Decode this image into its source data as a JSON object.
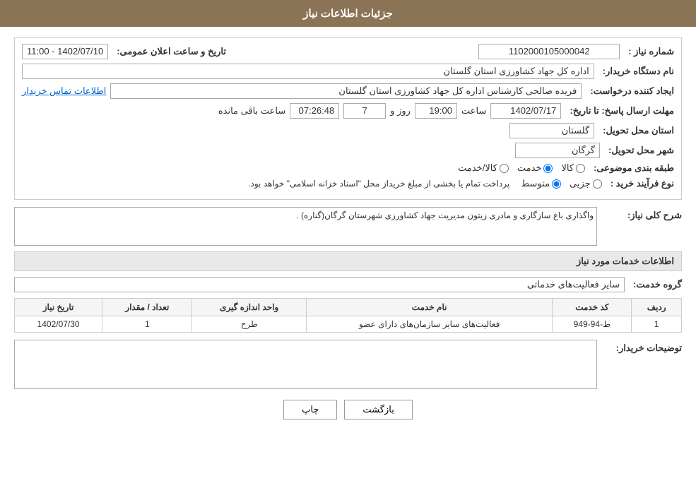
{
  "header": {
    "title": "جزئیات اطلاعات نیاز"
  },
  "fields": {
    "shomare_niaz_label": "شماره نیاز :",
    "shomare_niaz_value": "1102000105000042",
    "nam_dastgah_label": "نام دستگاه خریدار:",
    "nam_dastgah_value": "اداره کل جهاد کشاورزی استان گلستان",
    "ijad_konande_label": "ایجاد کننده درخواست:",
    "ijad_konande_value": "فریده صالحی کارشناس اداره کل جهاد کشاورزی استان گلستان",
    "ettelaat_tamas_label": "اطلاعات تماس خریدار",
    "mohlat_label": "مهلت ارسال پاسخ: تا تاریخ:",
    "date_value": "1402/07/17",
    "saat_label": "ساعت",
    "saat_value": "19:00",
    "roz_label": "روز و",
    "roz_value": "7",
    "saat_baqi_label": "ساعت باقی مانده",
    "saat_baqi_value": "07:26:48",
    "ostan_tahvil_label": "استان محل تحویل:",
    "ostan_tahvil_value": "گلستان",
    "shahr_tahvil_label": "شهر محل تحویل:",
    "shahr_tahvil_value": "گرگان",
    "tabaqe_label": "طبقه بندی موضوعی:",
    "tabaqe_kala_label": "کالا",
    "tabaqe_khedmat_label": "خدمت",
    "tabaqe_kala_khedmat_label": "کالا/خدمت",
    "tabaqe_selected": "khedmat",
    "nooe_farayand_label": "نوع فرآیند خرید :",
    "nooe_jozi_label": "جزیی",
    "nooe_motevaset_label": "متوسط",
    "nooe_text": "پرداخت تمام یا بخشی از مبلغ خریداز محل \"اسناد خزانه اسلامی\" خواهد بود.",
    "tarikh_elan_label": "تاریخ و ساعت اعلان عمومی:",
    "tarikh_elan_value": "1402/07/10 - 11:00"
  },
  "sherh_section": {
    "title": "شرح کلی نیاز:",
    "content": "واگذاری باغ سازگاری و مادری زیتون مدیریت جهاد کشاورزی شهرستان گرگان(گناره) ."
  },
  "khedamat_section": {
    "title": "اطلاعات خدمات مورد نیاز",
    "grooh_label": "گروه خدمت:",
    "grooh_value": "سایر فعالیت‌های خدماتی",
    "table": {
      "headers": [
        "ردیف",
        "کد خدمت",
        "نام خدمت",
        "واحد اندازه گیری",
        "تعداد / مقدار",
        "تاریخ نیاز"
      ],
      "rows": [
        {
          "radif": "1",
          "kod_khedmat": "ط-94-949",
          "nam_khedmat": "فعالیت‌های سایر سازمان‌های دارای عضو",
          "vahed": "طرح",
          "tedad": "1",
          "tarikh": "1402/07/30"
        }
      ]
    }
  },
  "tozihat_section": {
    "title": "توضیحات خریدار:",
    "content": ""
  },
  "buttons": {
    "print_label": "چاپ",
    "back_label": "بازگشت"
  }
}
